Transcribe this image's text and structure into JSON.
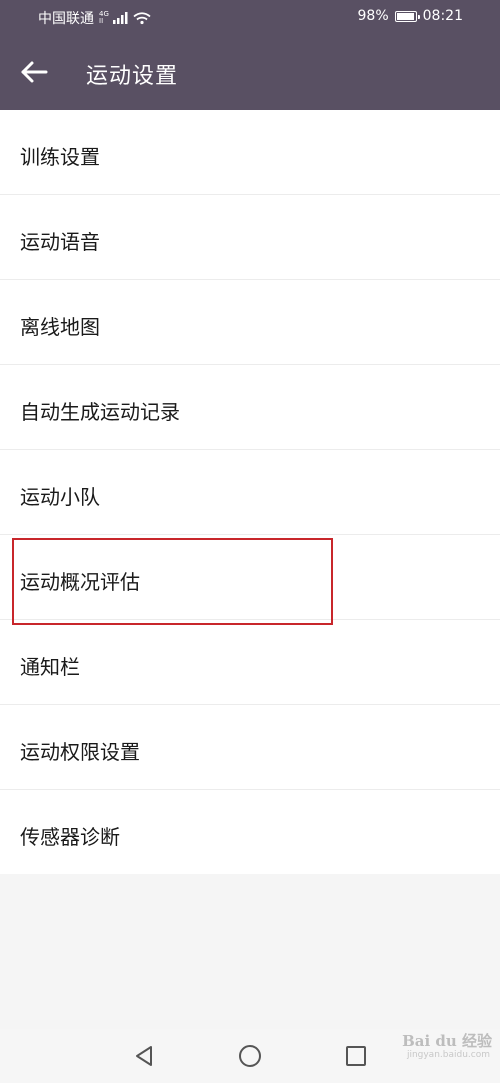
{
  "status_bar": {
    "carrier": "中国联通",
    "network_top": "4G",
    "network_bottom": "II",
    "battery": "98%",
    "time": "08:21",
    "battery_level": 0.98
  },
  "app_bar": {
    "title": "运动设置",
    "back_icon": "arrow-left-icon"
  },
  "settings": {
    "items": [
      {
        "label": "训练设置"
      },
      {
        "label": "运动语音"
      },
      {
        "label": "离线地图"
      },
      {
        "label": "自动生成运动记录"
      },
      {
        "label": "运动小队"
      },
      {
        "label": "运动概况评估"
      },
      {
        "label": "通知栏"
      },
      {
        "label": "运动权限设置"
      },
      {
        "label": "传感器诊断"
      }
    ],
    "highlighted_index": 5
  },
  "colors": {
    "header": "#595063",
    "highlight": "#c8262b",
    "background": "#f5f5f5"
  },
  "watermark": {
    "main": "Bai du 经验",
    "sub": "jingyan.baidu.com"
  },
  "nav": {
    "back_icon": "triangle-back-icon",
    "home_icon": "circle-home-icon",
    "recent_icon": "square-recent-icon"
  }
}
